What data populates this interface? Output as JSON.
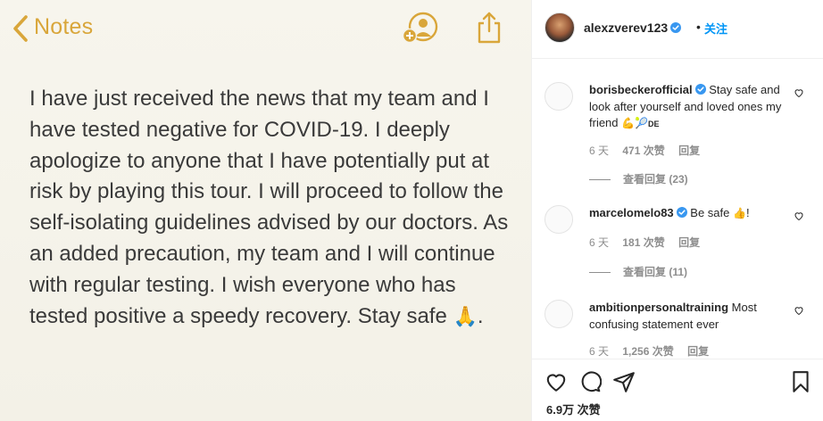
{
  "notes": {
    "back_label": "Notes",
    "body_text": "I have just received the news that my team and I have tested negative for COVID-19. I deeply apologize to anyone that I have potentially put at risk by playing this tour. I will proceed to follow the self-isolating guidelines advised by our doctors. As an added precaution, my team and I will continue with regular testing. I wish everyone who has tested positive a speedy recovery. Stay safe",
    "body_end_emoji": "🙏",
    "body_end_punct": ".",
    "accent_color": "#d9a63a"
  },
  "post": {
    "username": "alexzverev123",
    "separator": "•",
    "follow_label": "关注",
    "likes_label": "6.9万 次赞"
  },
  "comments": [
    {
      "user": "borisbeckerofficial",
      "text": "Stay safe and look after yourself and loved ones my friend",
      "emoji": "💪🎾",
      "flag": "DE",
      "time": "6 天",
      "likes": "471 次赞",
      "reply": "回复",
      "view_replies": "查看回复 (23)"
    },
    {
      "user": "marcelomelo83",
      "text": "Be safe",
      "emoji": "👍",
      "suffix": "!",
      "time": "6 天",
      "likes": "181 次赞",
      "reply": "回复",
      "view_replies": "查看回复 (11)"
    },
    {
      "user": "ambitionpersonaltraining",
      "text": "Most confusing statement ever",
      "time": "6 天",
      "likes": "1,256 次赞",
      "reply": "回复"
    }
  ],
  "colors": {
    "link_blue": "#0095f6",
    "verified_blue": "#3897f0",
    "meta_gray": "#8e8e8e",
    "text_dark": "#262626"
  }
}
